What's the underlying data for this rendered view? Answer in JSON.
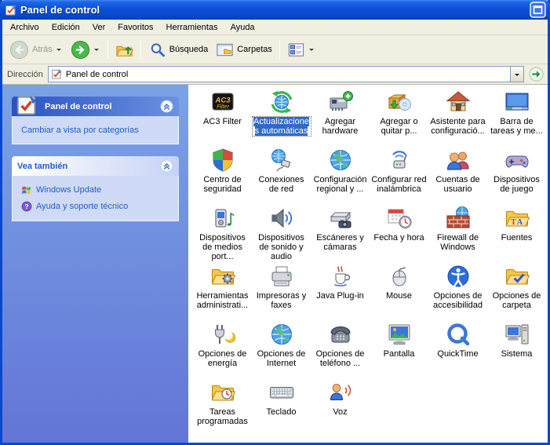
{
  "window": {
    "title": "Panel de control",
    "icon": "control-panel",
    "buttons": {
      "maximize_icon": "window-maximize"
    }
  },
  "menu": {
    "items": [
      "Archivo",
      "Edición",
      "Ver",
      "Favoritos",
      "Herramientas",
      "Ayuda"
    ]
  },
  "toolbar": {
    "back": {
      "label": "Atrás",
      "icon": "nav-back",
      "disabled": true,
      "dropdown": true
    },
    "forward": {
      "icon": "nav-forward",
      "dropdown": true
    },
    "up": {
      "icon": "folder-up"
    },
    "search": {
      "label": "Búsqueda",
      "icon": "search"
    },
    "folders": {
      "label": "Carpetas",
      "icon": "folders-pane"
    },
    "views": {
      "icon": "views-grid",
      "dropdown": true
    }
  },
  "addressbar": {
    "label": "Dirección",
    "value": "Panel de control",
    "icon": "control-panel",
    "go_icon": "go-arrow"
  },
  "sidebar": {
    "control_panel_panel": {
      "title": "Panel de control",
      "icon": "control-panel",
      "chevron_icon": "chevron-up",
      "links": [
        {
          "label": "Cambiar a vista por categorías",
          "icon": null
        }
      ]
    },
    "see_also_panel": {
      "title": "Vea también",
      "chevron_icon": "chevron-up",
      "links": [
        {
          "label": "Windows Update",
          "icon": "windows-update"
        },
        {
          "label": "Ayuda y soporte técnico",
          "icon": "help"
        }
      ]
    }
  },
  "icons": {
    "items": [
      {
        "label": "AC3 Filter",
        "icon": "ac3-filter",
        "selected": false
      },
      {
        "label": "Actualizaciones automáticas",
        "icon": "automatic-updates",
        "selected": true
      },
      {
        "label": "Agregar hardware",
        "icon": "add-hardware",
        "selected": false
      },
      {
        "label": "Agregar o quitar p...",
        "icon": "add-remove-programs",
        "selected": false
      },
      {
        "label": "Asistente para configuració...",
        "icon": "network-setup-wizard",
        "selected": false
      },
      {
        "label": "Barra de tareas y me...",
        "icon": "taskbar-start-menu",
        "selected": false
      },
      {
        "label": "Centro de seguridad",
        "icon": "security-center",
        "selected": false
      },
      {
        "label": "Conexiones de red",
        "icon": "network-connections",
        "selected": false
      },
      {
        "label": "Configuración regional y ...",
        "icon": "regional-settings",
        "selected": false
      },
      {
        "label": "Configurar red inalámbrica",
        "icon": "wireless-network-setup",
        "selected": false
      },
      {
        "label": "Cuentas de usuario",
        "icon": "user-accounts",
        "selected": false
      },
      {
        "label": "Dispositivos de juego",
        "icon": "game-controllers",
        "selected": false
      },
      {
        "label": "Dispositivos de medios port...",
        "icon": "portable-media-devices",
        "selected": false
      },
      {
        "label": "Dispositivos de sonido y audio",
        "icon": "sounds-audio-devices",
        "selected": false
      },
      {
        "label": "Escáneres y cámaras",
        "icon": "scanners-cameras",
        "selected": false
      },
      {
        "label": "Fecha y hora",
        "icon": "date-time",
        "selected": false
      },
      {
        "label": "Firewall de Windows",
        "icon": "windows-firewall",
        "selected": false
      },
      {
        "label": "Fuentes",
        "icon": "fonts",
        "selected": false
      },
      {
        "label": "Herramientas administrati...",
        "icon": "administrative-tools",
        "selected": false
      },
      {
        "label": "Impresoras y faxes",
        "icon": "printers-faxes",
        "selected": false
      },
      {
        "label": "Java Plug-in",
        "icon": "java-plugin",
        "selected": false
      },
      {
        "label": "Mouse",
        "icon": "mouse",
        "selected": false
      },
      {
        "label": "Opciones de accesibilidad",
        "icon": "accessibility-options",
        "selected": false
      },
      {
        "label": "Opciones de carpeta",
        "icon": "folder-options",
        "selected": false
      },
      {
        "label": "Opciones de energía",
        "icon": "power-options",
        "selected": false
      },
      {
        "label": "Opciones de Internet",
        "icon": "internet-options",
        "selected": false
      },
      {
        "label": "Opciones de teléfono ...",
        "icon": "phone-modem-options",
        "selected": false
      },
      {
        "label": "Pantalla",
        "icon": "display",
        "selected": false
      },
      {
        "label": "QuickTime",
        "icon": "quicktime",
        "selected": false
      },
      {
        "label": "Sistema",
        "icon": "system",
        "selected": false
      },
      {
        "label": "Tareas programadas",
        "icon": "scheduled-tasks",
        "selected": false
      },
      {
        "label": "Teclado",
        "icon": "keyboard",
        "selected": false
      },
      {
        "label": "Voz",
        "icon": "voice",
        "selected": false
      }
    ]
  }
}
